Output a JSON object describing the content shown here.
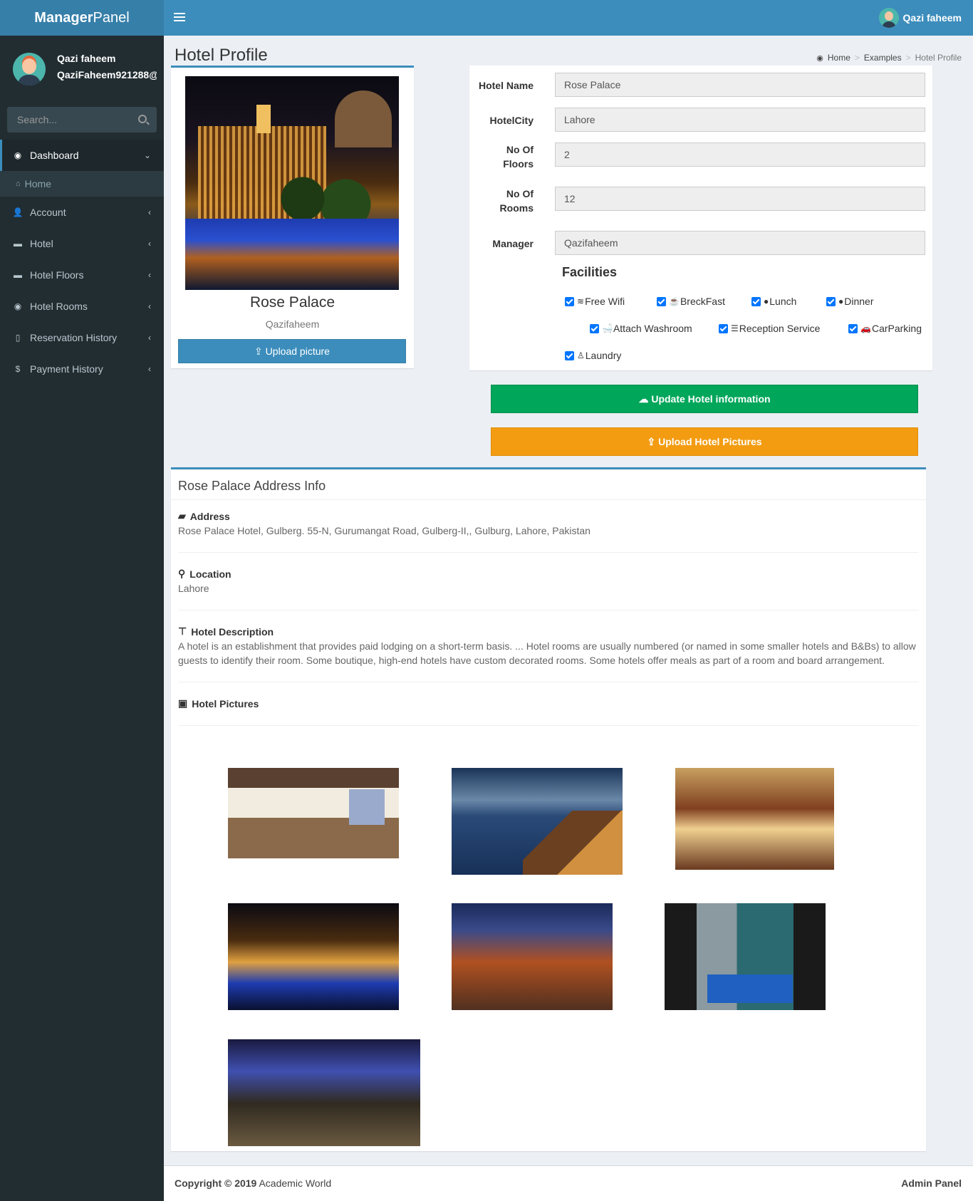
{
  "brand": {
    "bold": "Manager",
    "rest": "Panel"
  },
  "topbar": {
    "user_name": "Qazi faheem"
  },
  "sidebar": {
    "user_name": "Qazi faheem",
    "user_email": "QaziFaheem921288@",
    "search_placeholder": "Search...",
    "items": [
      {
        "label": "Dashboard",
        "icon": "dashboard-icon"
      },
      {
        "label": "Home",
        "icon": "home-icon"
      },
      {
        "label": "Account",
        "icon": "user-plus-icon"
      },
      {
        "label": "Hotel",
        "icon": "bed-icon"
      },
      {
        "label": "Hotel Floors",
        "icon": "bed-icon"
      },
      {
        "label": "Hotel Rooms",
        "icon": "dashboard-icon"
      },
      {
        "label": "Reservation History",
        "icon": "mobile-icon"
      },
      {
        "label": "Payment History",
        "icon": "dollar-icon"
      }
    ]
  },
  "page": {
    "title": "Hotel Profile"
  },
  "breadcrumb": {
    "home": "Home",
    "examples": "Examples",
    "current": "Hotel Profile"
  },
  "profile": {
    "name": "Rose Palace",
    "manager": "Qazifaheem",
    "upload_label": "Upload picture"
  },
  "form": {
    "hotel_name_label": "Hotel Name",
    "hotel_name": "Rose Palace",
    "hotel_city_label": "HotelCity",
    "hotel_city": "Lahore",
    "floors_label_1": "No Of",
    "floors_label_2": "Floors",
    "floors": "2",
    "rooms_label_1": "No Of",
    "rooms_label_2": "Rooms",
    "rooms": "12",
    "manager_label": "Manager",
    "manager": "Qazifaheem",
    "facilities_title": "Facilities",
    "facilities": [
      "Free Wifi",
      "BreckFast",
      "Lunch",
      "Dinner",
      "Attach Washroom",
      "Reception Service",
      "CarParking",
      "Laundry"
    ]
  },
  "actions": {
    "update": "Update Hotel information",
    "upload_pictures": "Upload Hotel Pictures"
  },
  "address_box": {
    "title": "Rose Palace Address Info",
    "address_label": "Address",
    "address": "Rose Palace Hotel, Gulberg. 55-N, Gurumangat Road, Gulberg-II,, Gulburg, Lahore, Pakistan",
    "location_label": "Location",
    "location": "Lahore",
    "description_label": "Hotel Description",
    "description": "A hotel is an establishment that provides paid lodging on a short-term basis. ... Hotel rooms are usually numbered (or named in some smaller hotels and B&Bs) to allow guests to identify their room. Some boutique, high-end hotels have custom decorated rooms. Some hotels offer meals as part of a room and board arrangement.",
    "pictures_label": "Hotel Pictures"
  },
  "footer": {
    "copyright_prefix": "Copyright © 2019",
    "company": "Academic World",
    "right": "Admin Panel"
  },
  "colors": {
    "primary": "#3c8dbc",
    "success": "#00a65a",
    "warning": "#f39c12",
    "sidebar": "#222d32"
  }
}
